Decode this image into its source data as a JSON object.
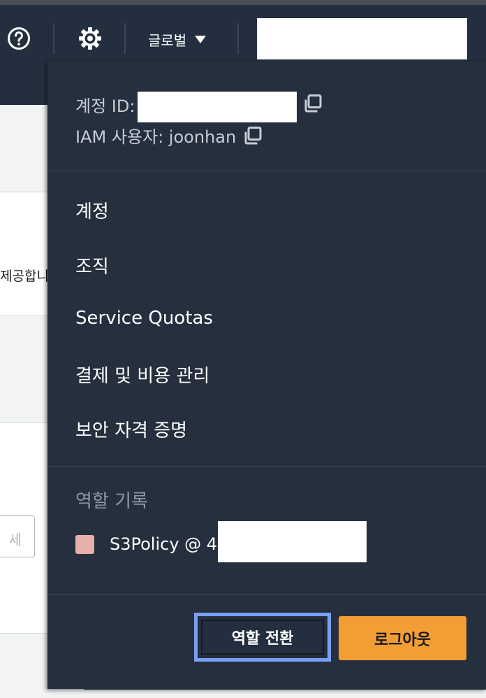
{
  "nav": {
    "region_label": "글로벌",
    "icons": {
      "help": "help-icon",
      "settings": "gear-icon",
      "caret": "caret-down-icon"
    }
  },
  "background": {
    "truncated_text": "제공합니다",
    "input_placeholder_fragment": "세"
  },
  "menu": {
    "account_id_label": "계정 ID:",
    "iam_user_label": "IAM 사용자: joonhan",
    "items": [
      "계정",
      "조직",
      "Service Quotas",
      "결제 및 비용 관리",
      "보안 자격 증명"
    ],
    "role_history_title": "역할 기록",
    "role_history": [
      {
        "label": "S3Policy @ 4",
        "color": "#e8b0ab"
      }
    ],
    "switch_role_label": "역할 전환",
    "logout_label": "로그아웃"
  },
  "colors": {
    "nav_bg": "#232f3e",
    "accent_orange": "#f29e35",
    "focus_blue": "#7aa0f2"
  }
}
